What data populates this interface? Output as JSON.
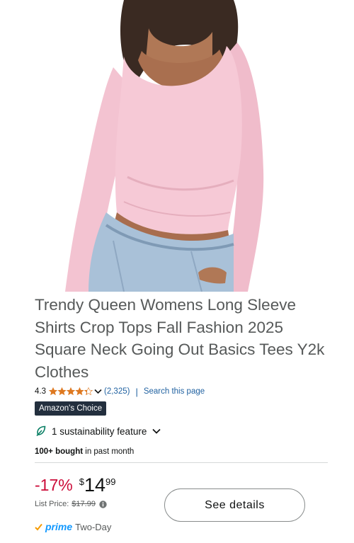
{
  "product": {
    "title": "Trendy Queen Womens Long Sleeve Shirts Crop Tops Fall Fashion 2025 Square Neck Going Out Basics Tees Y2k Clothes",
    "image_alt": "Pink long sleeve square neck crop top worn with light blue jeans"
  },
  "rating": {
    "value": "4.3",
    "stars": 4.3,
    "count": "(2,325)",
    "separator": "|",
    "search_link": "Search this page"
  },
  "badge": {
    "label": "Amazon's Choice"
  },
  "sustainability": {
    "label": "1 sustainability feature"
  },
  "bought": {
    "bold": "100+ bought",
    "rest": " in past month"
  },
  "price": {
    "discount": "-17%",
    "symbol": "$",
    "whole": "14",
    "fraction": "99",
    "list_label": "List Price:",
    "list_value": "$17.99"
  },
  "delivery": {
    "prime": "prime",
    "speed": "Two-Day"
  },
  "actions": {
    "see_details": "See details"
  },
  "colors": {
    "discount": "#cc0c39",
    "link": "#2162a1",
    "badge_bg": "#232f3e",
    "prime_blue": "#1399ff",
    "star": "#de7921",
    "shirt": "#f4c6d3"
  },
  "icons": [
    "star-icon",
    "chevron-down-icon",
    "leaf-icon",
    "info-icon",
    "prime-check-icon"
  ]
}
